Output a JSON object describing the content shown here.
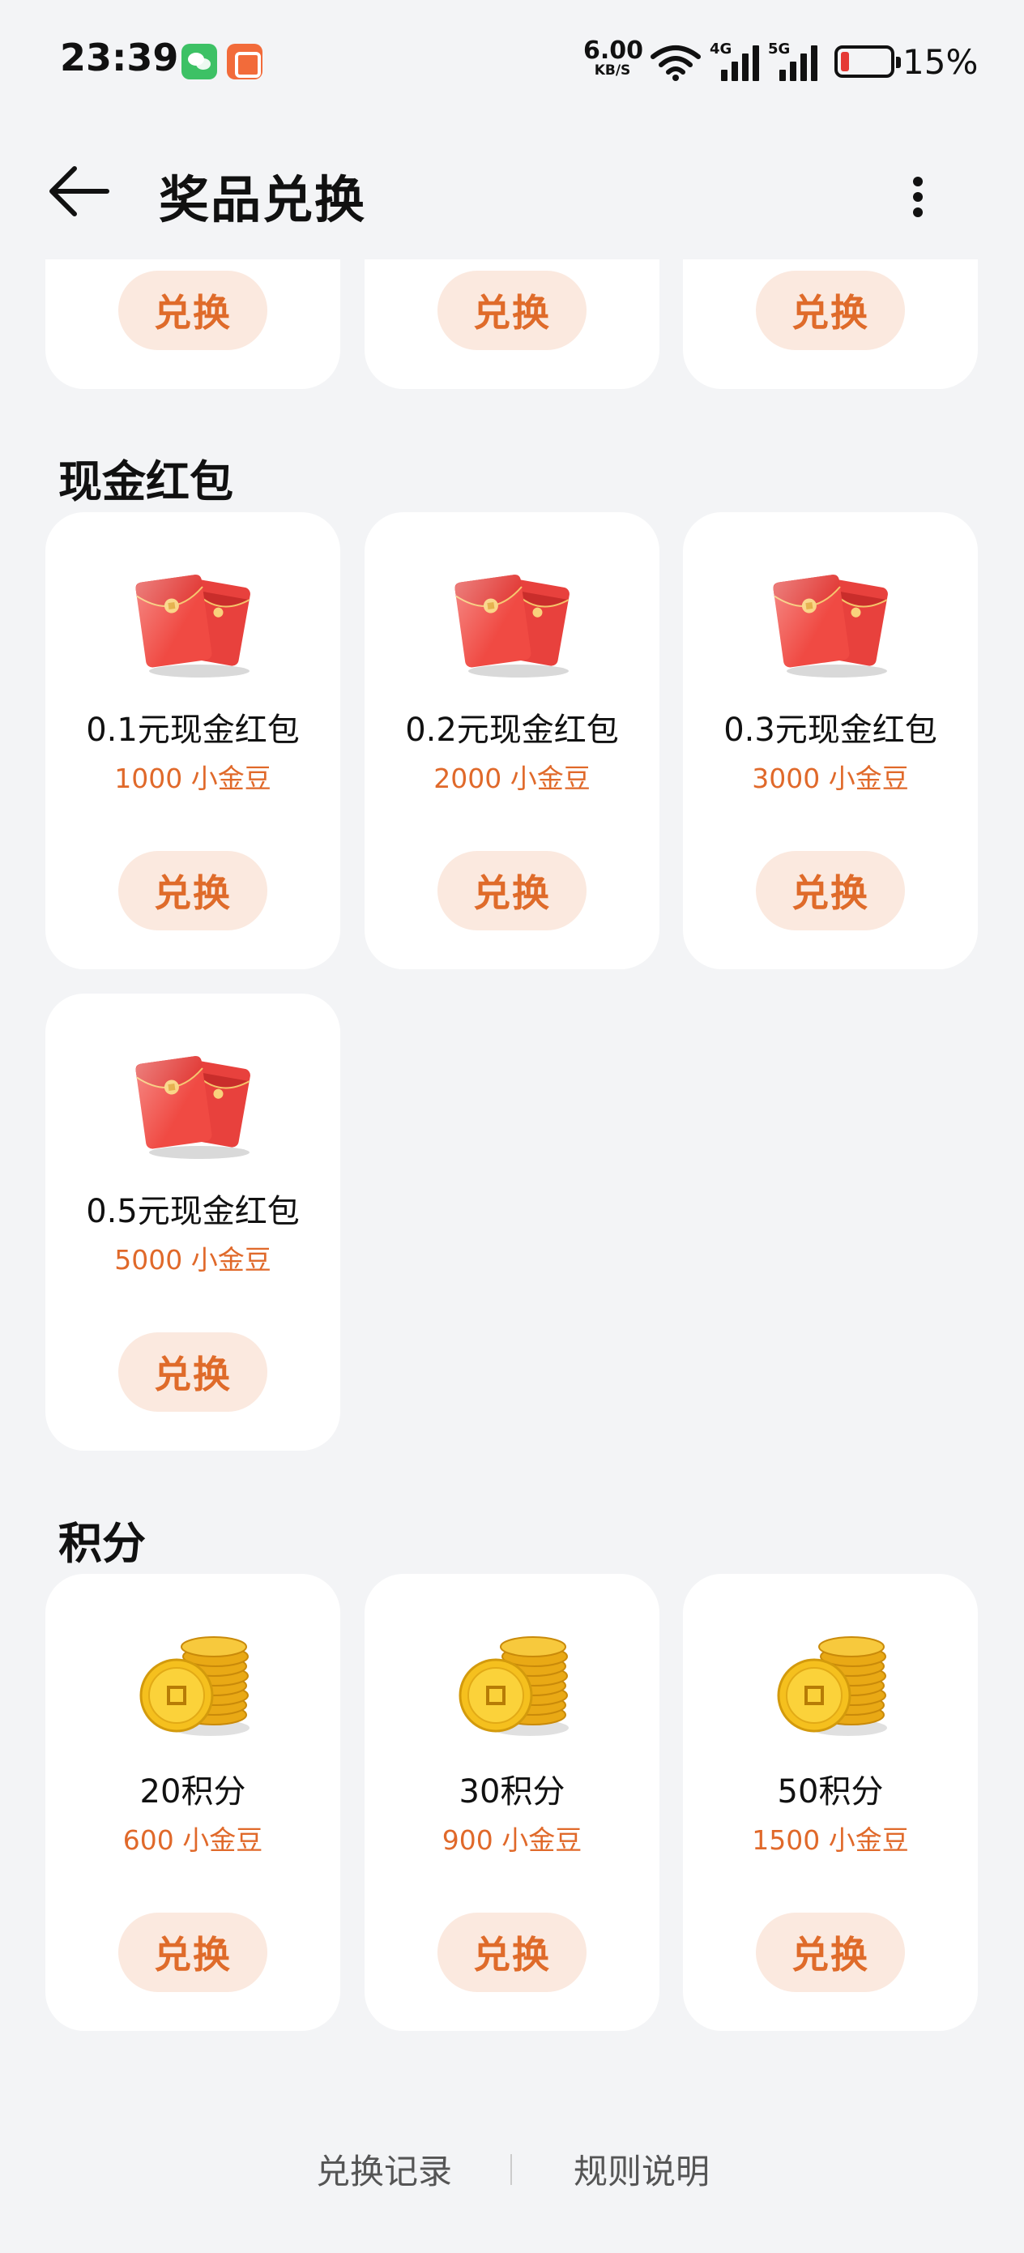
{
  "status": {
    "time": "23:39",
    "speed_value": "6.00",
    "speed_unit": "KB/S",
    "net_4g": "4G",
    "net_5g": "5G",
    "battery": "15%",
    "battery_color": "#e53935",
    "app_icons": [
      "wechat-icon",
      "kuaishou-icon"
    ]
  },
  "header": {
    "title": "奖品兑换",
    "back_icon": "arrow-left-icon",
    "more_icon": "more-vertical-icon"
  },
  "accent_color": "#df6b2a",
  "top_row": {
    "buttons": [
      "兑换",
      "兑换",
      "兑换"
    ]
  },
  "sections": [
    {
      "title": "现金红包",
      "icon": "red-envelope-icon",
      "items": [
        {
          "name": "0.1元现金红包",
          "cost": "1000 小金豆",
          "button": "兑换"
        },
        {
          "name": "0.2元现金红包",
          "cost": "2000 小金豆",
          "button": "兑换"
        },
        {
          "name": "0.3元现金红包",
          "cost": "3000 小金豆",
          "button": "兑换"
        },
        {
          "name": "0.5元现金红包",
          "cost": "5000 小金豆",
          "button": "兑换"
        }
      ]
    },
    {
      "title": "积分",
      "icon": "gold-coins-icon",
      "items": [
        {
          "name": "20积分",
          "cost": "600 小金豆",
          "button": "兑换"
        },
        {
          "name": "30积分",
          "cost": "900 小金豆",
          "button": "兑换"
        },
        {
          "name": "50积分",
          "cost": "1500 小金豆",
          "button": "兑换"
        }
      ]
    }
  ],
  "footer": {
    "record_link": "兑换记录",
    "rules_link": "规则说明"
  }
}
